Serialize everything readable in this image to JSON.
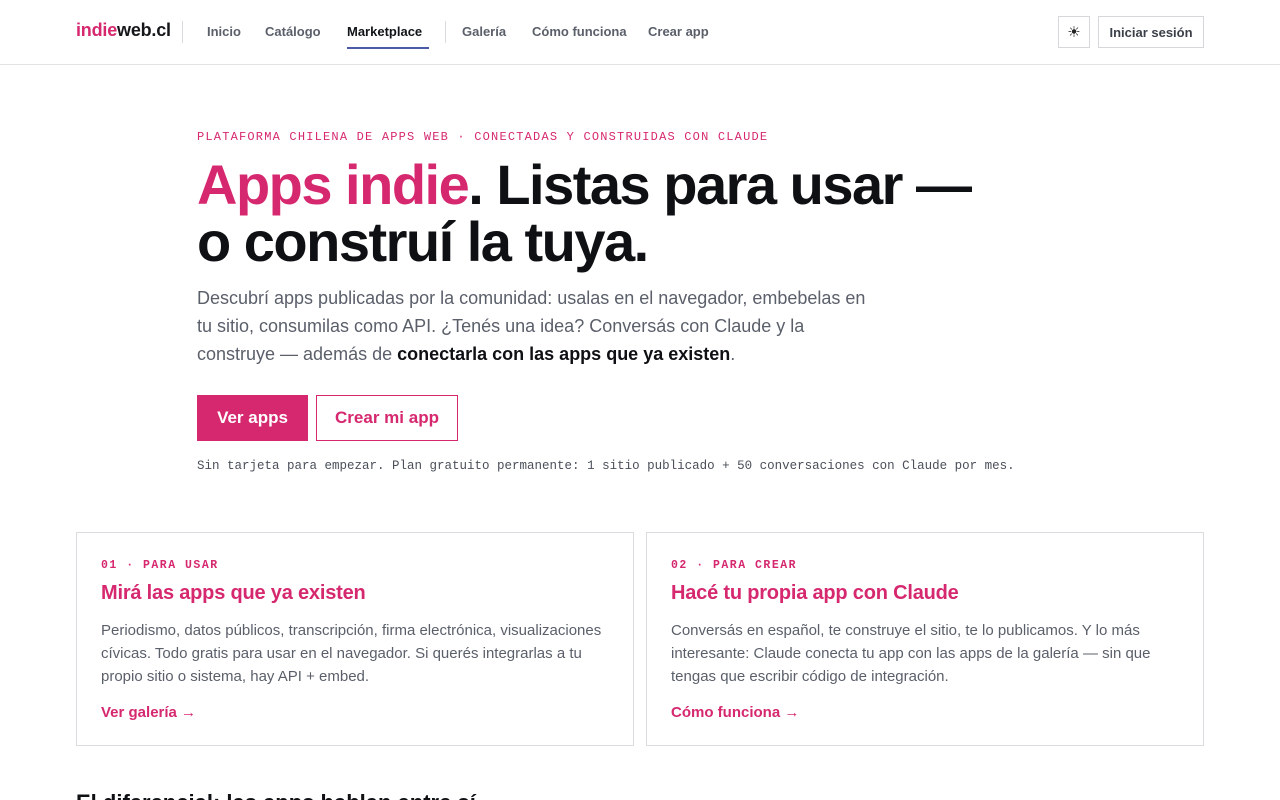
{
  "header": {
    "logo": {
      "part1": "indie",
      "part2": "web.cl"
    },
    "nav": [
      {
        "label": "Inicio"
      },
      {
        "label": "Catálogo"
      },
      {
        "label": "Marketplace"
      },
      {
        "label": "Galería"
      },
      {
        "label": "Cómo funciona"
      },
      {
        "label": "Crear app"
      }
    ],
    "active_nav": "Marketplace",
    "theme_icon": "☀",
    "login_label": "Iniciar sesión"
  },
  "hero": {
    "eyebrow": "PLATAFORMA CHILENA DE APPS WEB · CONECTADAS Y CONSTRUIDAS CON CLAUDE",
    "title_highlight": "Apps indie",
    "title_line1_rest": ". Listas para usar —",
    "title_line2": "o construí la tuya.",
    "desc_before": "Descubrí apps publicadas por la comunidad: usalas en el navegador, embebelas en tu sitio, consumilas como API. ¿Tenés una idea? Conversás con Claude y la construye — además de ",
    "desc_bold": "conectarla con las apps que ya existen",
    "desc_after": ".",
    "primary_button": "Ver apps",
    "secondary_button": "Crear mi app",
    "fineprint": "Sin tarjeta para empezar. Plan gratuito permanente: 1 sitio publicado + 50 conversaciones con Claude por mes."
  },
  "cards": [
    {
      "eyebrow": "01 · PARA USAR",
      "title": "Mirá las apps que ya existen",
      "text": "Periodismo, datos públicos, transcripción, firma electrónica, visualizaciones cívicas. Todo gratis para usar en el navegador. Si querés integrarlas a tu propio sitio o sistema, hay API + embed.",
      "link": "Ver galería →"
    },
    {
      "eyebrow": "02 · PARA CREAR",
      "title": "Hacé tu propia app con Claude",
      "text": "Conversás en español, te construye el sitio, te lo publicamos. Y lo más interesante: Claude conecta tu app con las apps de la galería — sin que tengas que escribir código de integración.",
      "link": "Cómo funciona →"
    }
  ],
  "bottom_heading": "El diferencial: las apps hablan entre sí",
  "colors": {
    "accent": "#d6286f",
    "text": "#0e1013",
    "muted": "#5a5f6a",
    "nav_underline": "#4b5ba6"
  }
}
